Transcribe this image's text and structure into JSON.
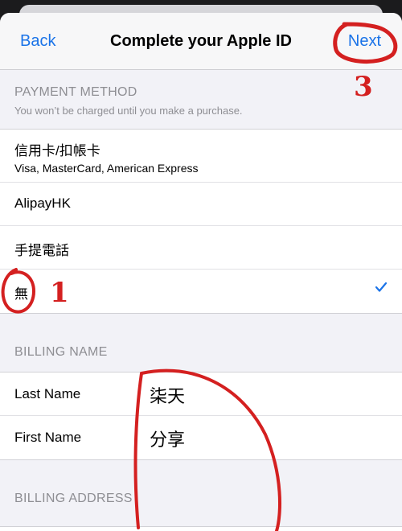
{
  "nav": {
    "back_label": "Back",
    "title": "Complete your Apple ID",
    "next_label": "Next"
  },
  "payment": {
    "header": "PAYMENT METHOD",
    "subheader": "You won’t be charged until you make a purchase.",
    "options": [
      {
        "label": "信用卡/扣帳卡",
        "sub": "Visa, MasterCard, American Express",
        "selected": false
      },
      {
        "label": "AlipayHK",
        "selected": false
      },
      {
        "label": "手提電話",
        "selected": false
      },
      {
        "label": "無",
        "selected": true
      }
    ]
  },
  "billing_name": {
    "header": "BILLING NAME",
    "last_name_label": "Last Name",
    "last_name_value": "柒天",
    "first_name_label": "First Name",
    "first_name_value": "分享"
  },
  "billing_address": {
    "header": "BILLING ADDRESS"
  },
  "annotations": {
    "step1": "1",
    "step3": "3"
  },
  "colors": {
    "accent": "#1a73e8",
    "annotation": "#d42020"
  },
  "icons": {
    "selected": "checkmark-icon"
  }
}
